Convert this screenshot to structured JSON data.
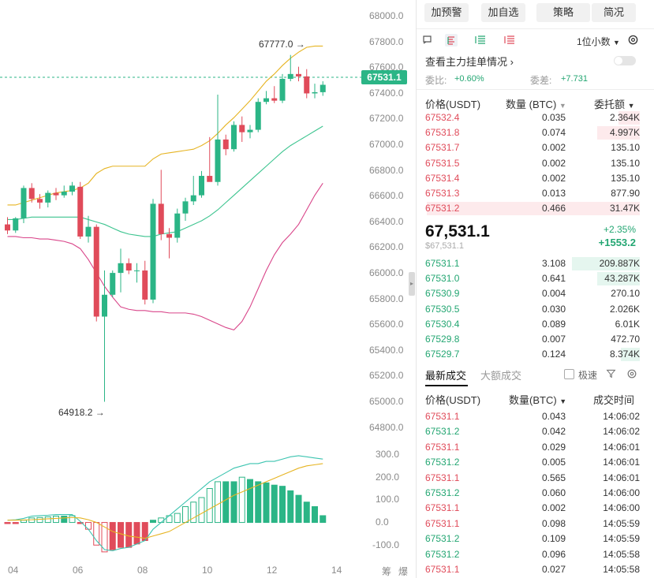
{
  "chart": {
    "y_axis_labels": [
      "68000.0",
      "67800.0",
      "67600.0",
      "67400.0",
      "67200.0",
      "67000.0",
      "66800.0",
      "66600.0",
      "66400.0",
      "66200.0",
      "66000.0",
      "65800.0",
      "65600.0",
      "65400.0",
      "65200.0",
      "65000.0",
      "64800.0"
    ],
    "x_axis_labels": [
      "04",
      "06",
      "08",
      "10",
      "12",
      "14"
    ],
    "macd_axis_labels": [
      "300.0",
      "200.0",
      "100.0",
      "0.0",
      "-100.0"
    ],
    "current_price_tag": "67531.1",
    "high_annotation": "67777.0 →",
    "low_annotation": "64918.2 →",
    "corner_labels": [
      "筹",
      "爆"
    ],
    "colors": {
      "up": "#2bb586",
      "down": "#e04b5a",
      "boll_upper": "#e6b422",
      "boll_mid": "#3cc48f",
      "boll_lower": "#d9468a",
      "dif": "#3cc4b0",
      "dea": "#e6b422"
    },
    "chart_data": {
      "type": "candlestick",
      "ylim": [
        64700,
        68100
      ],
      "candles": [
        {
          "o": 66380,
          "h": 66440,
          "l": 66300,
          "c": 66330
        },
        {
          "o": 66330,
          "h": 66440,
          "l": 66310,
          "c": 66430
        },
        {
          "o": 66430,
          "h": 66700,
          "l": 66390,
          "c": 66680
        },
        {
          "o": 66680,
          "h": 66720,
          "l": 66560,
          "c": 66590
        },
        {
          "o": 66590,
          "h": 66630,
          "l": 66510,
          "c": 66560
        },
        {
          "o": 66560,
          "h": 66660,
          "l": 66520,
          "c": 66640
        },
        {
          "o": 66640,
          "h": 66680,
          "l": 66580,
          "c": 66620
        },
        {
          "o": 66620,
          "h": 66700,
          "l": 66600,
          "c": 66650
        },
        {
          "o": 66650,
          "h": 66730,
          "l": 66620,
          "c": 66700
        },
        {
          "o": 66690,
          "h": 66730,
          "l": 66260,
          "c": 66280
        },
        {
          "o": 66280,
          "h": 66450,
          "l": 66230,
          "c": 66360
        },
        {
          "o": 66360,
          "h": 66380,
          "l": 65580,
          "c": 65620
        },
        {
          "o": 65620,
          "h": 66000,
          "l": 64918,
          "c": 65800
        },
        {
          "o": 65800,
          "h": 66000,
          "l": 65780,
          "c": 65980
        },
        {
          "o": 65980,
          "h": 66180,
          "l": 65820,
          "c": 66060
        },
        {
          "o": 66060,
          "h": 66100,
          "l": 65970,
          "c": 66000
        },
        {
          "o": 66000,
          "h": 66060,
          "l": 65900,
          "c": 66000
        },
        {
          "o": 66000,
          "h": 66080,
          "l": 65720,
          "c": 65760
        },
        {
          "o": 65760,
          "h": 66590,
          "l": 65730,
          "c": 66550
        },
        {
          "o": 66550,
          "h": 66830,
          "l": 66250,
          "c": 66300
        },
        {
          "o": 66300,
          "h": 66350,
          "l": 66100,
          "c": 66270
        },
        {
          "o": 66270,
          "h": 66510,
          "l": 66230,
          "c": 66470
        },
        {
          "o": 66470,
          "h": 66600,
          "l": 66410,
          "c": 66570
        },
        {
          "o": 66570,
          "h": 66780,
          "l": 66540,
          "c": 66620
        },
        {
          "o": 66620,
          "h": 66820,
          "l": 66600,
          "c": 66780
        },
        {
          "o": 66780,
          "h": 67100,
          "l": 66760,
          "c": 66730
        },
        {
          "o": 66730,
          "h": 67450,
          "l": 66700,
          "c": 67080
        },
        {
          "o": 67080,
          "h": 67120,
          "l": 66950,
          "c": 67000
        },
        {
          "o": 67000,
          "h": 67230,
          "l": 66980,
          "c": 67200
        },
        {
          "o": 67200,
          "h": 67270,
          "l": 67060,
          "c": 67140
        },
        {
          "o": 67140,
          "h": 67200,
          "l": 67090,
          "c": 67160
        },
        {
          "o": 67160,
          "h": 67420,
          "l": 67140,
          "c": 67390
        },
        {
          "o": 67390,
          "h": 67480,
          "l": 67370,
          "c": 67420
        },
        {
          "o": 67420,
          "h": 67520,
          "l": 67380,
          "c": 67400
        },
        {
          "o": 67400,
          "h": 67620,
          "l": 67380,
          "c": 67580
        },
        {
          "o": 67580,
          "h": 67777,
          "l": 67560,
          "c": 67620
        },
        {
          "o": 67620,
          "h": 67680,
          "l": 67560,
          "c": 67600
        },
        {
          "o": 67600,
          "h": 67660,
          "l": 67420,
          "c": 67460
        },
        {
          "o": 67460,
          "h": 67540,
          "l": 67420,
          "c": 67470
        },
        {
          "o": 67470,
          "h": 67560,
          "l": 67440,
          "c": 67531
        }
      ],
      "boll_upper": [
        66540,
        66540,
        66560,
        66580,
        66600,
        66620,
        66640,
        66650,
        66660,
        66680,
        66720,
        66800,
        66840,
        66860,
        66860,
        66860,
        66860,
        66860,
        66920,
        66960,
        66970,
        66980,
        66990,
        67000,
        67030,
        67070,
        67130,
        67200,
        67260,
        67330,
        67400,
        67480,
        67560,
        67620,
        67690,
        67750,
        67800,
        67840,
        67850,
        67850
      ],
      "boll_mid": [
        66420,
        66420,
        66430,
        66440,
        66440,
        66440,
        66440,
        66440,
        66440,
        66440,
        66420,
        66400,
        66380,
        66350,
        66320,
        66300,
        66290,
        66280,
        66280,
        66300,
        66310,
        66320,
        66350,
        66380,
        66410,
        66450,
        66500,
        66560,
        66620,
        66680,
        66740,
        66800,
        66860,
        66920,
        66980,
        67030,
        67070,
        67110,
        67150,
        67190
      ],
      "boll_lower": [
        66280,
        66280,
        66270,
        66270,
        66260,
        66260,
        66250,
        66240,
        66220,
        66180,
        66090,
        65980,
        65870,
        65780,
        65700,
        65680,
        65670,
        65670,
        65660,
        65660,
        65650,
        65650,
        65650,
        65640,
        65620,
        65590,
        65560,
        65530,
        65510,
        65580,
        65700,
        65850,
        66000,
        66130,
        66230,
        66300,
        66380,
        66500,
        66620,
        66720
      ],
      "macd_ylim": [
        -120,
        340
      ],
      "macd_hist": [
        -5,
        -5,
        10,
        20,
        22,
        25,
        28,
        28,
        30,
        -5,
        -30,
        -100,
        -130,
        -120,
        -110,
        -110,
        -95,
        -80,
        10,
        20,
        30,
        40,
        70,
        90,
        110,
        150,
        180,
        180,
        180,
        200,
        190,
        180,
        175,
        165,
        160,
        140,
        120,
        90,
        70,
        30
      ],
      "dif": [
        10,
        12,
        18,
        28,
        30,
        32,
        35,
        35,
        35,
        5,
        -30,
        -80,
        -120,
        -125,
        -115,
        -110,
        -95,
        -80,
        -30,
        0,
        30,
        60,
        90,
        120,
        150,
        180,
        200,
        220,
        240,
        250,
        260,
        260,
        270,
        270,
        280,
        290,
        295,
        290,
        285,
        280
      ],
      "dea": [
        10,
        10,
        11,
        12,
        14,
        16,
        18,
        20,
        22,
        20,
        12,
        0,
        -20,
        -40,
        -50,
        -60,
        -65,
        -70,
        -60,
        -50,
        -40,
        -20,
        0,
        20,
        40,
        60,
        80,
        100,
        120,
        135,
        150,
        165,
        180,
        195,
        210,
        225,
        240,
        250,
        255,
        260
      ]
    }
  },
  "panel": {
    "buttons": [
      "加预警",
      "加自选",
      "策略",
      "简况"
    ],
    "precision": "1位小数",
    "main_orders_link": "查看主力挂单情况",
    "ratio_label": "委比:",
    "ratio_value": "+0.60%",
    "diff_label": "委差:",
    "diff_value": "+7.731",
    "book_headers": {
      "price": "价格(USDT)",
      "qty": "数量 (BTC)",
      "total": "委托额"
    },
    "asks": [
      {
        "p": "67532.4",
        "q": "0.035",
        "t": "2.364K",
        "depth": 0.1
      },
      {
        "p": "67531.8",
        "q": "0.074",
        "t": "4.997K",
        "depth": 0.2
      },
      {
        "p": "67531.7",
        "q": "0.002",
        "t": "135.10",
        "depth": 0.0
      },
      {
        "p": "67531.5",
        "q": "0.002",
        "t": "135.10",
        "depth": 0.0
      },
      {
        "p": "67531.4",
        "q": "0.002",
        "t": "135.10",
        "depth": 0.0
      },
      {
        "p": "67531.3",
        "q": "0.013",
        "t": "877.90",
        "depth": 0.0
      },
      {
        "p": "67531.2",
        "q": "0.466",
        "t": "31.47K",
        "depth": 1.0
      }
    ],
    "last_price": "67,531.1",
    "last_price_sub": "$67,531.1",
    "change_pct": "+2.35%",
    "change_abs": "+1553.2",
    "bids": [
      {
        "p": "67531.1",
        "q": "3.108",
        "t": "209.887K",
        "depth": 0.32
      },
      {
        "p": "67531.0",
        "q": "0.641",
        "t": "43.287K",
        "depth": 0.2
      },
      {
        "p": "67530.9",
        "q": "0.004",
        "t": "270.10",
        "depth": 0.0
      },
      {
        "p": "67530.5",
        "q": "0.030",
        "t": "2.026K",
        "depth": 0.0
      },
      {
        "p": "67530.4",
        "q": "0.089",
        "t": "6.01K",
        "depth": 0.0
      },
      {
        "p": "67529.8",
        "q": "0.007",
        "t": "472.70",
        "depth": 0.0
      },
      {
        "p": "67529.7",
        "q": "0.124",
        "t": "8.374K",
        "depth": 0.09
      }
    ],
    "trades_tab_latest": "最新成交",
    "trades_tab_large": "大额成交",
    "fast_mode_label": "极速",
    "trade_headers": {
      "price": "价格(USDT)",
      "qty": "数量(BTC)",
      "time": "成交时间"
    },
    "trades": [
      {
        "p": "67531.1",
        "q": "0.043",
        "t": "14:06:02",
        "side": "sell"
      },
      {
        "p": "67531.2",
        "q": "0.042",
        "t": "14:06:02",
        "side": "buy"
      },
      {
        "p": "67531.1",
        "q": "0.029",
        "t": "14:06:01",
        "side": "sell"
      },
      {
        "p": "67531.2",
        "q": "0.005",
        "t": "14:06:01",
        "side": "buy"
      },
      {
        "p": "67531.1",
        "q": "0.565",
        "t": "14:06:01",
        "side": "sell"
      },
      {
        "p": "67531.2",
        "q": "0.060",
        "t": "14:06:00",
        "side": "buy"
      },
      {
        "p": "67531.1",
        "q": "0.002",
        "t": "14:06:00",
        "side": "sell"
      },
      {
        "p": "67531.1",
        "q": "0.098",
        "t": "14:05:59",
        "side": "sell"
      },
      {
        "p": "67531.2",
        "q": "0.109",
        "t": "14:05:59",
        "side": "buy"
      },
      {
        "p": "67531.2",
        "q": "0.096",
        "t": "14:05:58",
        "side": "buy"
      },
      {
        "p": "67531.1",
        "q": "0.027",
        "t": "14:05:58",
        "side": "sell"
      }
    ]
  }
}
